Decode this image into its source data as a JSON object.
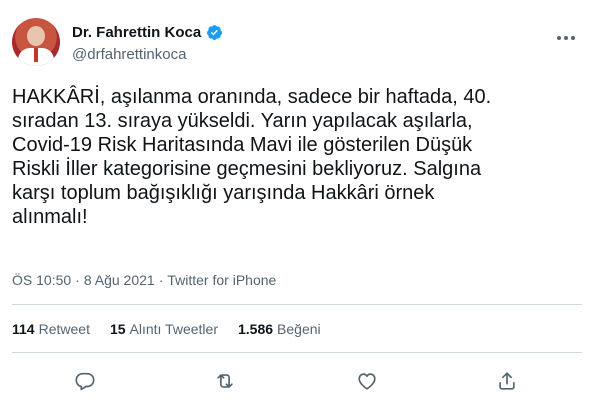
{
  "author": {
    "display_name": "Dr. Fahrettin Koca",
    "handle": "@drfahrettinkoca",
    "verified": true
  },
  "tweet": {
    "text": "HAKKÂRİ, aşılanma oranında, sadece bir haftada, 40.\nsıradan 13. sıraya yükseldi. Yarın yapılacak aşılarla,\nCovid-19 Risk Haritasında Mavi ile gösterilen Düşük\nRiskli İller kategorisine geçmesini bekliyoruz. Salgına\nkarşı toplum bağışıklığı yarışında Hakkâri örnek\nalınmalı!"
  },
  "meta": {
    "time": "ÖS 10:50",
    "separator1": "·",
    "date": "8 Ağu 2021",
    "separator2": "·",
    "source": "Twitter for iPhone"
  },
  "stats": [
    {
      "number": "114",
      "label": "Retweet"
    },
    {
      "number": "15",
      "label": "Alıntı Tweetler"
    },
    {
      "number": "1.586",
      "label": "Beğeni"
    }
  ],
  "icons": {
    "verified": "verified-badge-icon",
    "more": "more-options-icon",
    "reply": "reply-icon",
    "retweet": "retweet-icon",
    "like": "heart-icon",
    "share": "share-icon"
  },
  "colors": {
    "text": "#0f1419",
    "secondary": "#536471",
    "verified": "#1d9bf0",
    "divider": "#cfd9de"
  }
}
